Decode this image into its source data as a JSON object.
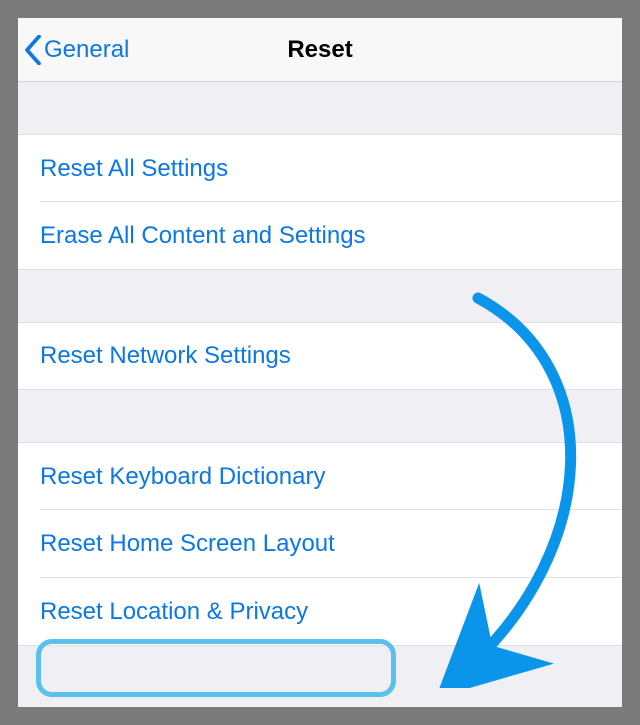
{
  "nav": {
    "back_label": "General",
    "title": "Reset"
  },
  "group1": [
    {
      "label": "Reset All Settings"
    },
    {
      "label": "Erase All Content and Settings"
    }
  ],
  "group2": [
    {
      "label": "Reset Network Settings"
    }
  ],
  "group3": [
    {
      "label": "Reset Keyboard Dictionary"
    },
    {
      "label": "Reset Home Screen Layout"
    },
    {
      "label": "Reset Location & Privacy"
    }
  ],
  "colors": {
    "link": "#0b78e3",
    "highlight": "#59c1ea",
    "arrow": "#0b95ea"
  }
}
